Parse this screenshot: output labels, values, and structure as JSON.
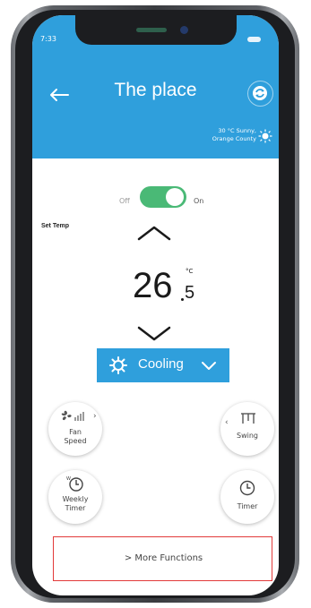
{
  "status_bar": {
    "time": "7:33"
  },
  "header": {
    "title": "The place",
    "weather": {
      "line1": "30 °C Sunny,",
      "line2": "Orange County"
    }
  },
  "power": {
    "off_label": "Off",
    "on_label": "On",
    "state": "on"
  },
  "temperature": {
    "label": "Set Temp",
    "integer": "26",
    "decimal": "5",
    "unit": "°C"
  },
  "mode": {
    "label": "Cooling"
  },
  "controls": {
    "fan_speed": "Fan\nSpeed",
    "swing": "Swing",
    "weekly_timer": "Weekly\nTimer",
    "timer": "Timer"
  },
  "more_functions": {
    "label": "> More Functions"
  },
  "colors": {
    "header_blue": "#2f9fdc",
    "toggle_green": "#4ab976",
    "more_border_red": "#e23a3a"
  },
  "icons": {
    "back": "back-arrow-icon",
    "refresh": "refresh-icon",
    "weather": "sun-icon",
    "mode": "snowflake-icon",
    "fan": "fan-icon",
    "swing": "swing-icon",
    "weekly_timer": "weekly-timer-icon",
    "timer": "clock-icon"
  }
}
